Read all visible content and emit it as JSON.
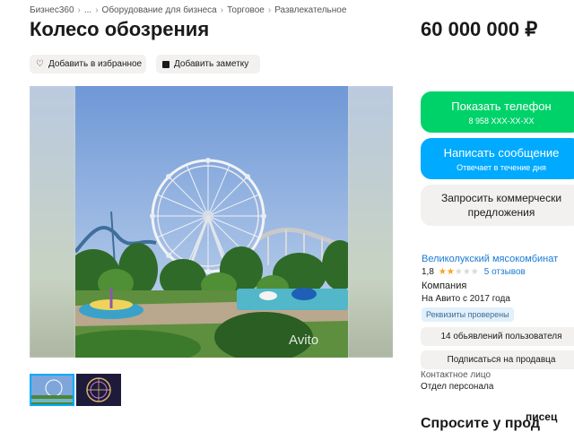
{
  "breadcrumb": {
    "items": [
      "Бизнес360",
      "...",
      "Оборудование для бизнеса",
      "Торговое",
      "Развлекательное"
    ],
    "separator": "›"
  },
  "listing": {
    "title": "Колесо обозрения",
    "price": "60 000 000 ₽"
  },
  "actions": {
    "favorite_label": "Добавить в избранное",
    "note_label": "Добавить заметку"
  },
  "gallery": {
    "watermark": "Avito"
  },
  "contact": {
    "show_phone_label": "Показать телефон",
    "phone_masked": "8 958 XXX-XX-XX",
    "write_message_label": "Написать сообщение",
    "write_message_sub": "Отвечает в течение дня",
    "request_offer_line1": "Запросить коммерчески",
    "request_offer_line2": "предложения"
  },
  "seller": {
    "name": "Великолукский мясокомбинат",
    "rating": "1,8",
    "rating_stars_filled": 2,
    "rating_stars_total": 5,
    "reviews": "5 отзывов",
    "type": "Компания",
    "since": "На Авито с 2017 года",
    "verified_badge": "Реквизиты проверены",
    "listings_button": "14 обьявлений пользователя",
    "subscribe_button": "Подписаться на продавца",
    "contact_person_label": "Контактное лицо",
    "contact_person": "Отдел персонала"
  },
  "below": {
    "cut_heading": "Спросите у прод"
  },
  "overlay_watermark": "писец",
  "colors": {
    "green_button": "#00d26a",
    "blue_button": "#00aaff",
    "gray_bg": "#f2f1f0",
    "link_blue": "#1a7ad4",
    "star": "#f5a623"
  }
}
